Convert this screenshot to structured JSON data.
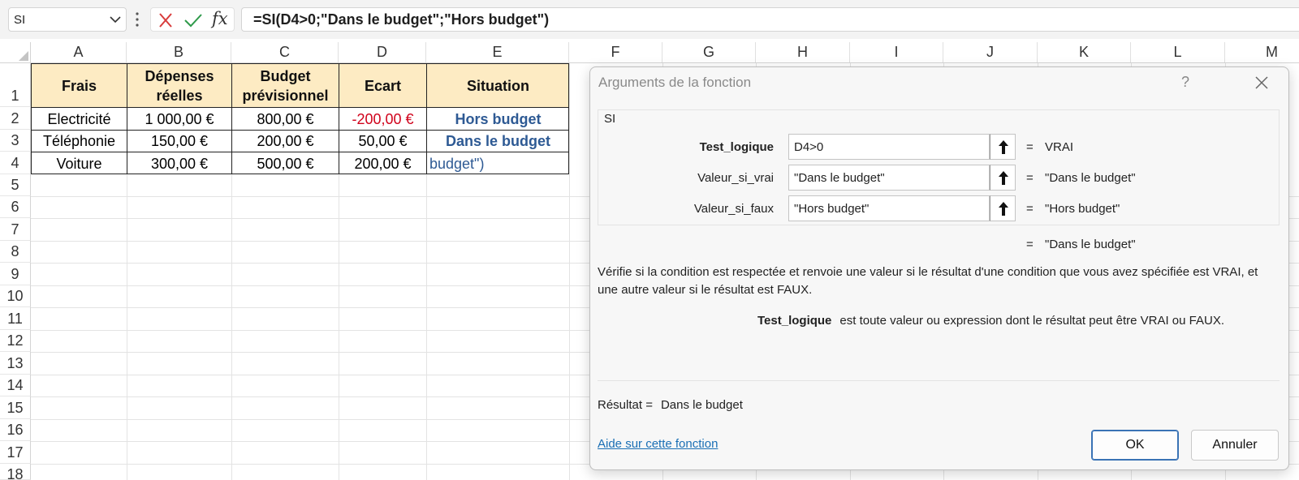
{
  "formula_bar": {
    "name_box": "SI",
    "cancel_icon": "close-icon",
    "enter_icon": "checkmark-icon",
    "fx_label": "fx",
    "formula": "=SI(D4>0;\"Dans le budget\";\"Hors budget\")"
  },
  "columns": [
    "A",
    "B",
    "C",
    "D",
    "E",
    "F",
    "G",
    "H",
    "I",
    "J",
    "K",
    "L",
    "M"
  ],
  "rows": [
    "1",
    "2",
    "3",
    "4",
    "5",
    "6",
    "7",
    "8",
    "9",
    "10",
    "11",
    "12",
    "13",
    "14",
    "15",
    "16",
    "17",
    "18"
  ],
  "table": {
    "headers": {
      "a": "Frais",
      "b1": "Dépenses",
      "b2": "réelles",
      "c1": "Budget",
      "c2": "prévisionnel",
      "d": "Ecart",
      "e": "Situation"
    },
    "rows": [
      {
        "frais": "Electricité",
        "depenses": "1 000,00 €",
        "budget": "800,00 €",
        "ecart": "-200,00 €",
        "situation": "Hors budget"
      },
      {
        "frais": "Téléphonie",
        "depenses": "150,00 €",
        "budget": "200,00 €",
        "ecart": "50,00 €",
        "situation": "Dans le budget"
      },
      {
        "frais": "Voiture",
        "depenses": "300,00 €",
        "budget": "500,00 €",
        "ecart": "200,00 €",
        "situation": "budget\")"
      }
    ]
  },
  "colors": {
    "header_fill": "#fdebc3",
    "situation_text": "#2e5a94",
    "negative_text": "#d0021b"
  },
  "dialog": {
    "title": "Arguments de la fonction",
    "help_glyph": "?",
    "function_name": "SI",
    "args": [
      {
        "label": "Test_logique",
        "value": "D4>0",
        "eq": "=",
        "result": "VRAI"
      },
      {
        "label": "Valeur_si_vrai",
        "value": "\"Dans le budget\"",
        "eq": "=",
        "result": "\"Dans le budget\""
      },
      {
        "label": "Valeur_si_faux",
        "value": "\"Hors budget\"",
        "eq": "=",
        "result": "\"Hors budget\""
      }
    ],
    "overall_eq": "=",
    "overall_result": "\"Dans le budget\"",
    "description_line1": "Vérifie si la condition est respectée et renvoie une valeur si le résultat d'une condition que vous avez spécifiée est VRAI, et",
    "description_line2": "une autre valeur si le résultat est FAUX.",
    "arg_help_name": "Test_logique",
    "arg_help_text": "est toute valeur ou expression dont le résultat peut être VRAI ou FAUX.",
    "result_label": "Résultat =",
    "result_value": "Dans le budget",
    "help_link": "Aide sur cette fonction",
    "ok_label": "OK",
    "cancel_label": "Annuler"
  }
}
